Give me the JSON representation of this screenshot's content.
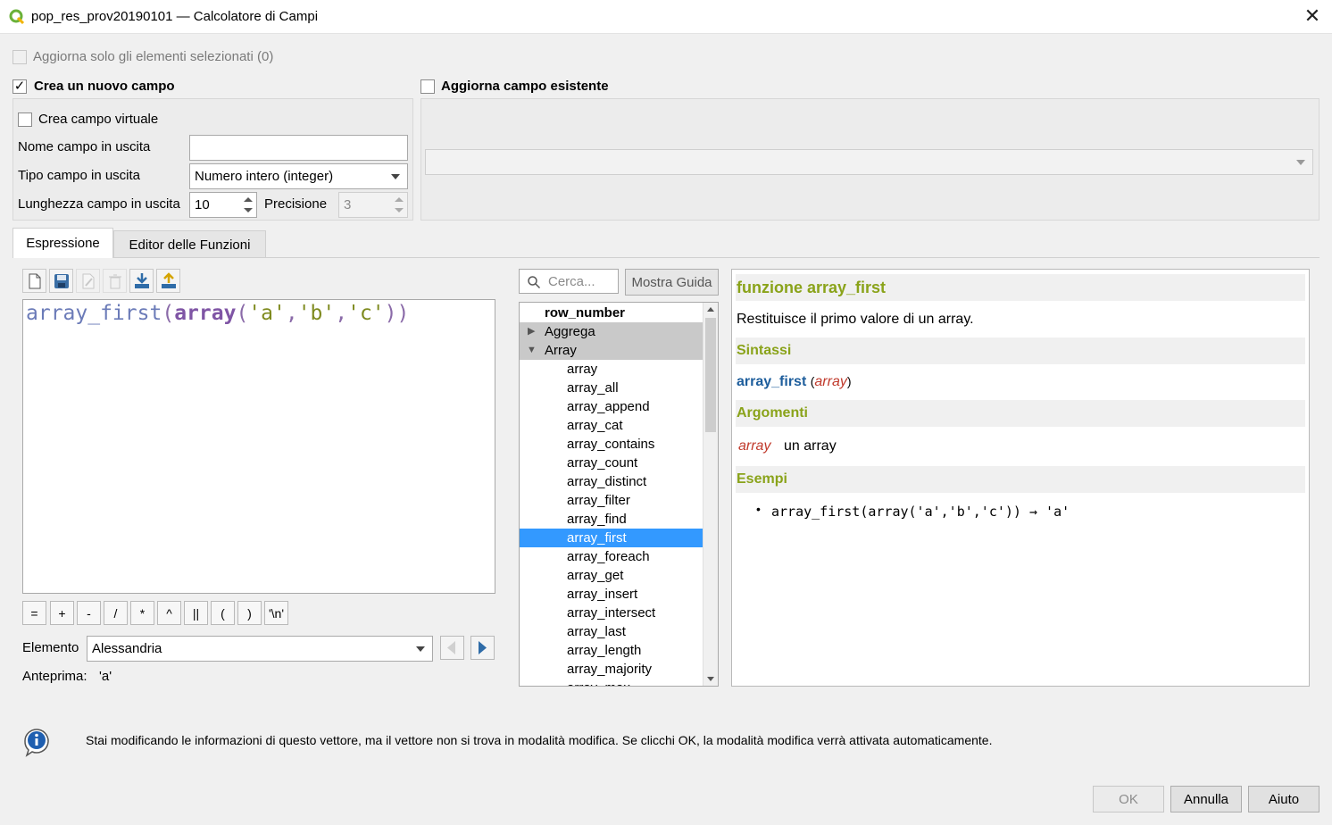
{
  "window": {
    "title": "pop_res_prov20190101 — Calcolatore di Campi",
    "close_glyph": "✕"
  },
  "options": {
    "update_selected_label": "Aggiorna solo gli elementi selezionati (0)",
    "update_selected_checked": false,
    "create_new_label": "Crea un nuovo campo",
    "create_new_checked": true,
    "update_existing_label": "Aggiorna campo esistente",
    "update_existing_checked": false
  },
  "new_field": {
    "virtual_label": "Crea campo virtuale",
    "name_label": "Nome campo in uscita",
    "name_value": "",
    "type_label": "Tipo campo in uscita",
    "type_value": "Numero intero (integer)",
    "length_label": "Lunghezza campo in uscita",
    "length_value": "10",
    "precision_label": "Precisione",
    "precision_value": "3"
  },
  "existing_field": {
    "value": ""
  },
  "tabs": {
    "expression": "Espressione",
    "function_editor": "Editor delle Funzioni"
  },
  "expression": {
    "parts": [
      "array_first",
      "(",
      "array",
      "(",
      "'a'",
      ",",
      "'b'",
      ",",
      "'c'",
      "))"
    ],
    "operators": [
      "=",
      "+",
      "-",
      "/",
      "*",
      "^",
      "||",
      "(",
      ")",
      "'\\n'"
    ],
    "element_label": "Elemento",
    "element_value": "Alessandria",
    "preview_label": "Anteprima:",
    "preview_value": "'a'"
  },
  "search": {
    "placeholder": "Cerca...",
    "help_button": "Mostra Guida"
  },
  "tree": {
    "top_item": "row_number",
    "groups": [
      "Aggrega",
      "Array"
    ],
    "items": [
      "array",
      "array_all",
      "array_append",
      "array_cat",
      "array_contains",
      "array_count",
      "array_distinct",
      "array_filter",
      "array_find",
      "array_first",
      "array_foreach",
      "array_get",
      "array_insert",
      "array_intersect",
      "array_last",
      "array_length",
      "array_majority",
      "array_max"
    ],
    "selected": "array_first"
  },
  "help": {
    "title": "funzione array_first",
    "description": "Restituisce il primo valore di un array.",
    "syntax_header": "Sintassi",
    "syntax_fn": "array_first",
    "syntax_open": "(",
    "syntax_arg": "array",
    "syntax_close": ")",
    "args_header": "Argomenti",
    "arg_name": "array",
    "arg_desc": "un array",
    "examples_header": "Esempi",
    "example": "array_first(array('a','b','c')) → 'a'"
  },
  "info_message": "Stai modificando le informazioni di questo vettore, ma il vettore non si trova in modalità modifica. Se clicchi OK, la modalità modifica verrà attivata automaticamente.",
  "buttons": {
    "ok": "OK",
    "cancel": "Annulla",
    "help": "Aiuto"
  },
  "colors": {
    "accent": "#8aa31a",
    "selection": "#3399ff",
    "syntax_fn": "#1e5e9c",
    "arg": "#c0392b"
  }
}
